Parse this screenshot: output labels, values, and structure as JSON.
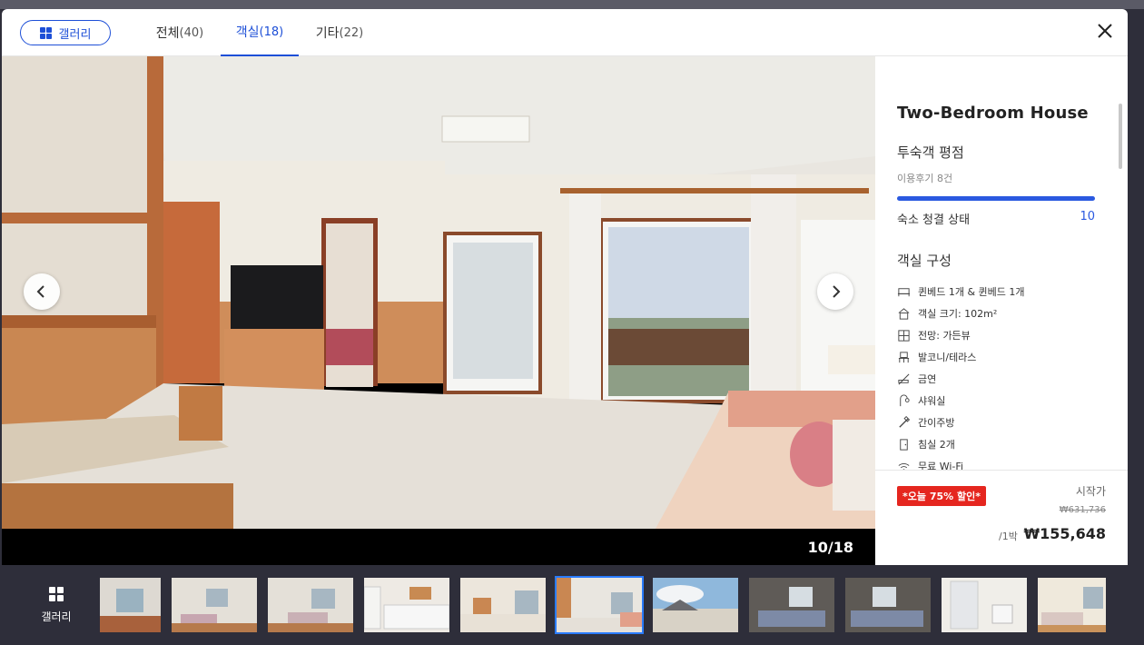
{
  "header": {
    "gallery_label": "갤러리",
    "tabs": [
      {
        "label": "전체",
        "count": "(40)"
      },
      {
        "label": "객실",
        "count": "(18)"
      },
      {
        "label": "기타",
        "count": "(22)"
      }
    ]
  },
  "photo": {
    "counter": "10/18"
  },
  "room": {
    "title": "Two-Bedroom House",
    "rating_heading": "투숙객 평점",
    "review_count": "이용후기 8건",
    "cleanliness_label": "숙소 청결 상태",
    "cleanliness_score": "10",
    "composition_heading": "객실 구성",
    "amenities": [
      {
        "icon": "bed-icon",
        "label": "퀸베드 1개 & 퀸베드 1개"
      },
      {
        "icon": "house-icon",
        "label": "객실 크기: 102m²"
      },
      {
        "icon": "window-icon",
        "label": "전망: 가든뷰"
      },
      {
        "icon": "balcony-icon",
        "label": "발코니/테라스"
      },
      {
        "icon": "no-smoking-icon",
        "label": "금연"
      },
      {
        "icon": "shower-icon",
        "label": "샤워실"
      },
      {
        "icon": "kitchen-icon",
        "label": "간이주방"
      },
      {
        "icon": "door-icon",
        "label": "침실 2개"
      },
      {
        "icon": "wifi-icon",
        "label": "무료 Wi-Fi"
      }
    ]
  },
  "price": {
    "discount_badge_prefix": "*오늘 ",
    "discount_percent": "75%",
    "discount_badge_suffix": " 할인*",
    "start_label": "시작가",
    "original": "₩631,736",
    "per_night": "/1박",
    "final": "₩155,648"
  },
  "thumbnails": {
    "gallery_label": "갤러리",
    "active_index": 5,
    "count": 11
  }
}
